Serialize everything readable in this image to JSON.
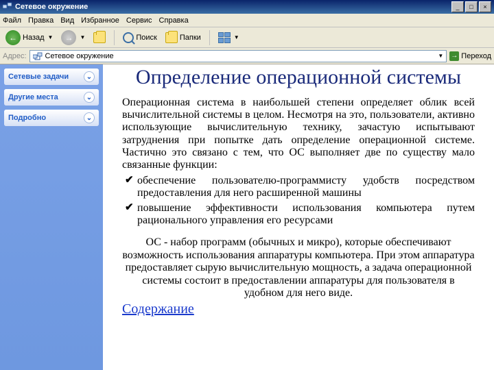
{
  "window": {
    "title": "Сетевое окружение",
    "buttons": {
      "min": "_",
      "max": "□",
      "close": "×"
    }
  },
  "menu": {
    "file": "Файл",
    "edit": "Правка",
    "view": "Вид",
    "favorites": "Избранное",
    "tools": "Сервис",
    "help": "Справка"
  },
  "toolbar": {
    "back": "Назад",
    "search": "Поиск",
    "folders": "Папки"
  },
  "address": {
    "label": "Адрес:",
    "value": "Сетевое окружение",
    "go": "Переход"
  },
  "sidebar": {
    "panels": [
      {
        "title": "Сетевые задачи"
      },
      {
        "title": "Другие места"
      },
      {
        "title": "Подробно"
      }
    ]
  },
  "document": {
    "title": "Определение операционной системы",
    "p1": "Операционная система в наибольшей степени определяет облик всей вычислительной системы в целом. Несмотря на это, пользователи, активно использующие вычислительную технику, зачастую испытывают затруднения при попытке дать определение операционной системе. Частично это связано с тем, что ОС выполняет две по существу мало связанные функции:",
    "li1": "обеспечение пользователю-программисту удобств посредством предоставления для него расширенной машины",
    "li2": "повышение эффективности использования компьютера путем рационального управления его ресурсами",
    "p2": "ОС - набор программ (обычных и микро), которые обеспечивают возможность использования аппаратуры компьютера. При этом аппаратура предоставляет сырую вычислительную мощность, а задача операционной системы состоит в предоставлении аппаратуры для пользователя в удобном для него виде.",
    "toc": "Содержание"
  }
}
